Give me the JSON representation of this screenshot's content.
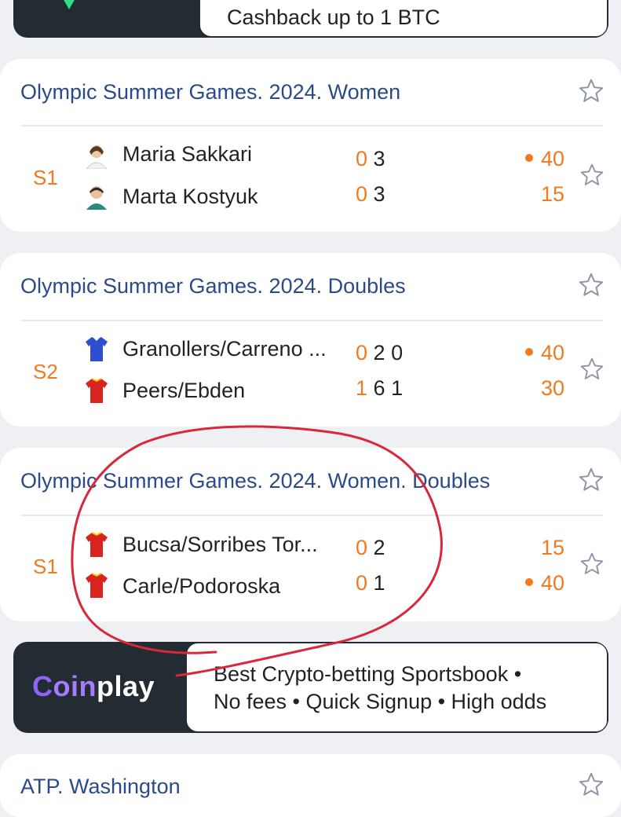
{
  "top_banner": {
    "line": "Cashback up to 1 BTC"
  },
  "cards": [
    {
      "title": "Olympic Summer Games. 2024. Women",
      "set": "S1",
      "players": [
        {
          "name": "Maria Sakkari",
          "game0": "0",
          "games": "3",
          "points": "40",
          "serving": true
        },
        {
          "name": "Marta Kostyuk",
          "game0": "0",
          "games": "3",
          "points": "15",
          "serving": false
        }
      ]
    },
    {
      "title": "Olympic Summer Games. 2024. Doubles",
      "set": "S2",
      "players": [
        {
          "name": "Granollers/Carreno ...",
          "game0": "0",
          "games": "2 0",
          "points": "40",
          "serving": true
        },
        {
          "name": "Peers/Ebden",
          "game0": "1",
          "games": "6 1",
          "points": "30",
          "serving": false
        }
      ]
    },
    {
      "title": "Olympic Summer Games. 2024. Women. Doubles",
      "set": "S1",
      "players": [
        {
          "name": "Bucsa/Sorribes Tor...",
          "game0": "0",
          "games": "2",
          "points": "15",
          "serving": false
        },
        {
          "name": "Carle/Podoroska",
          "game0": "0",
          "games": "1",
          "points": "40",
          "serving": true
        }
      ]
    },
    {
      "title": "ATP. Washington"
    }
  ],
  "coinplay_banner": {
    "logo_c": "C",
    "logo_rest_orange": "oin",
    "logo_rest_white": "play",
    "line1": "Best Crypto-betting Sportsbook •",
    "line2": "No fees • Quick Signup • High odds"
  },
  "colors": {
    "accent": "#f07a1f",
    "title_blue": "#2a4a8a",
    "banner_dark": "#232b33",
    "annotation_red": "#d8283a"
  }
}
